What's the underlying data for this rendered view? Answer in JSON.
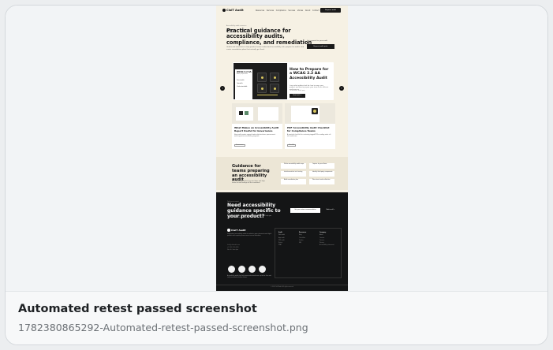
{
  "caption": {
    "title": "Automated retest passed screenshot",
    "filename": "1782380865292-Automated-retest-passed-screenshot.png"
  },
  "site": {
    "logo": "ClaIT Audit",
    "nav": "Resources  Services  Compliance  Success stories  About  Contact",
    "header_cta": "Request audit",
    "tags": [
      "Blog",
      "Tips"
    ],
    "eyebrow": "Accessibility audit resources",
    "hero_title": "Practical guidance for accessibility audits, compliance, and remediation",
    "hero_subtitle": "Guides and checklists to help product teams understand accessibility risk, prepare for audits, and create remediation plans that actually get fixed.",
    "hero_box_text": "Get a quote for your audit",
    "hero_box_button": "Request audit quote",
    "featured": {
      "card_title": "WCAG 2.2 AA",
      "card_sub": "Audit preparation",
      "card_items": [
        "Perceivable",
        "Operable",
        "Understandable"
      ],
      "title": "How to Prepare for a WCAG 2.2 AA Accessibility Audit",
      "description": "Learn what auditors look for, how to scope your product, and how to prepare your team for an efficient audit process.",
      "meta": "10 min read · Audit prep",
      "button": "Read article →"
    },
    "cards": [
      {
        "title": "What Makes an Accessibility Audit Report Useful for Governance",
        "description": "How audit reports support leadership decisions, procurement, and long-term accessibility programs.",
        "tag": "Governance"
      },
      {
        "title": "PDF Accessibility Audit Checklist for Compliance Teams",
        "description": "A practical checklist for reviewing tagged PDFs, reading order, alt text and forms.",
        "tag": "Checklist"
      }
    ],
    "guide": {
      "title": "Guidance for teams preparing an accessibility audit",
      "description": "Start with scope, collect key user flows, and align teams on how findings will be remediated.",
      "items": [
        "Define accessibility audit scope",
        "Capture key user flows",
        "Include assistive tech testing",
        "Identify third-party components",
        "Build remediation plan",
        "Plan retests and verification"
      ]
    },
    "dark": {
      "eyebrow": "Talk to an expert",
      "title": "Need accessibility guidance specific to your product?",
      "description": "Share your product, timeline and compliance goals. We'll help you choose the right audit approach.",
      "button_primary": "Get your custom recommendation",
      "button_secondary": "Book a call →"
    },
    "footer": {
      "logo": "ClaIT Audit",
      "description": "Independent accessibility audits for websites, apps, documents and digital products with reporting teams can act on and remediate.",
      "contact_lines": [
        "hello@claitaudit.com",
        "+1 (555) 010-2026",
        "Mon–Fri, 9am–6pm"
      ],
      "columns": [
        {
          "heading": "Audit",
          "links": [
            "Web audit",
            "App audit",
            "PDF audit",
            "Retest",
            "VPAT"
          ]
        },
        {
          "heading": "Resources",
          "links": [
            "Blog",
            "Checklists",
            "Guides",
            "FAQ"
          ]
        },
        {
          "heading": "Company",
          "links": [
            "About",
            "Contact",
            "Careers",
            "Privacy",
            "Accessibility statement"
          ]
        }
      ],
      "bottom_text": "Accessibility audits that help teams understand issues, prioritise fixes and verify remediation before release.",
      "copyright": "© 2026 ClaIT Audit. All rights reserved."
    }
  },
  "icons": {
    "prev": "chevron-left-icon",
    "next": "chevron-right-icon"
  },
  "colors": {
    "page_bg": "#f6f1e4",
    "dark_bg": "#141516",
    "accent": "#1a1a1a"
  }
}
